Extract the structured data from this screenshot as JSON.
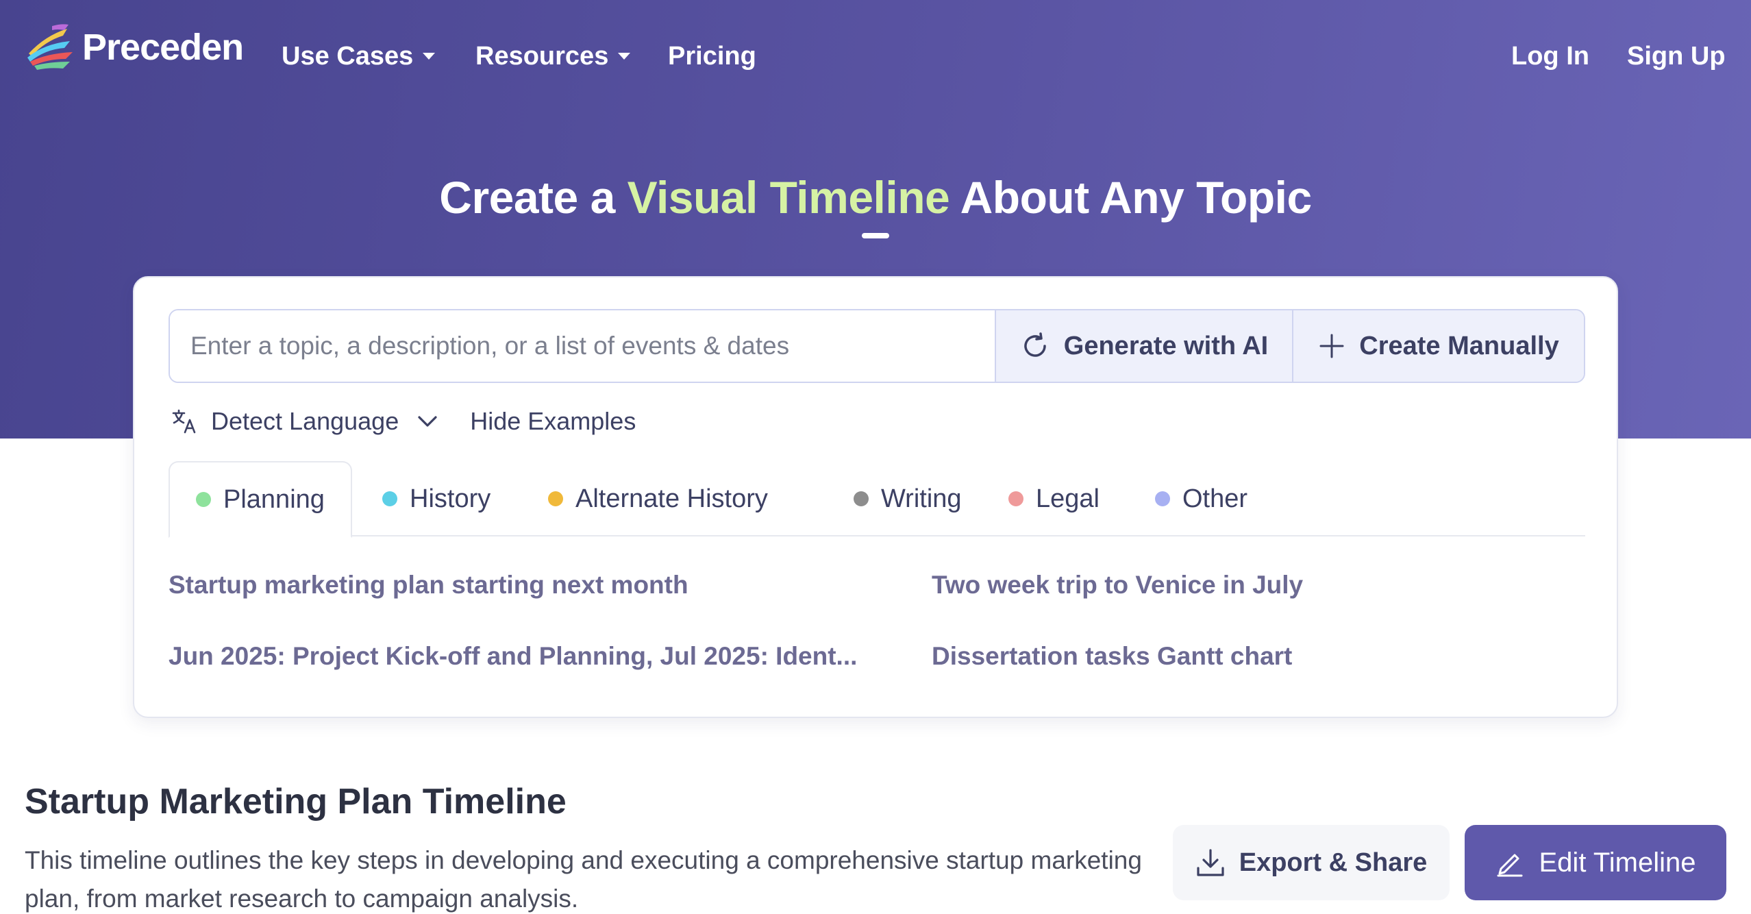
{
  "brand": {
    "name": "Preceden"
  },
  "nav": {
    "use_cases": "Use Cases",
    "resources": "Resources",
    "pricing": "Pricing",
    "login": "Log In",
    "signup": "Sign Up"
  },
  "hero": {
    "headline_before": "Create a ",
    "headline_highlight": "Visual Timeline",
    "headline_after": " About Any Topic"
  },
  "search": {
    "placeholder": "Enter a topic, a description, or a list of events & dates",
    "value": "",
    "generate_label": "Generate with AI",
    "manual_label": "Create Manually"
  },
  "language": {
    "selected": "Detect Language",
    "hide_examples": "Hide Examples"
  },
  "tabs": [
    {
      "label": "Planning",
      "color": "#8ee29c",
      "active": true
    },
    {
      "label": "History",
      "color": "#5ccfe6"
    },
    {
      "label": "Alternate History",
      "color": "#f0b93a"
    },
    {
      "label": "Writing",
      "color": "#8d8d8d"
    },
    {
      "label": "Legal",
      "color": "#ef9a9a"
    },
    {
      "label": "Other",
      "color": "#a7b0f2"
    }
  ],
  "examples": [
    "Startup marketing plan starting next month",
    "Two week trip to Venice in July",
    "Jun 2025: Project Kick-off and Planning, Jul 2025: Ident...",
    "Dissertation tasks Gantt chart"
  ],
  "timeline": {
    "title": "Startup Marketing Plan Timeline",
    "description": "This timeline outlines the key steps in developing and executing a comprehensive startup marketing plan, from market research to campaign analysis.",
    "export_label": "Export & Share",
    "edit_label": "Edit Timeline"
  },
  "colors": {
    "hero_start": "#48448f",
    "hero_end": "#6a65b6",
    "highlight": "#d6f2a4",
    "primary_button": "#5f59ab",
    "example_link": "#6c6a93"
  },
  "icons": [
    "logo-icon",
    "refresh-icon",
    "plus-icon",
    "translate-icon",
    "chevron-down-icon",
    "download-icon",
    "pen-icon"
  ]
}
